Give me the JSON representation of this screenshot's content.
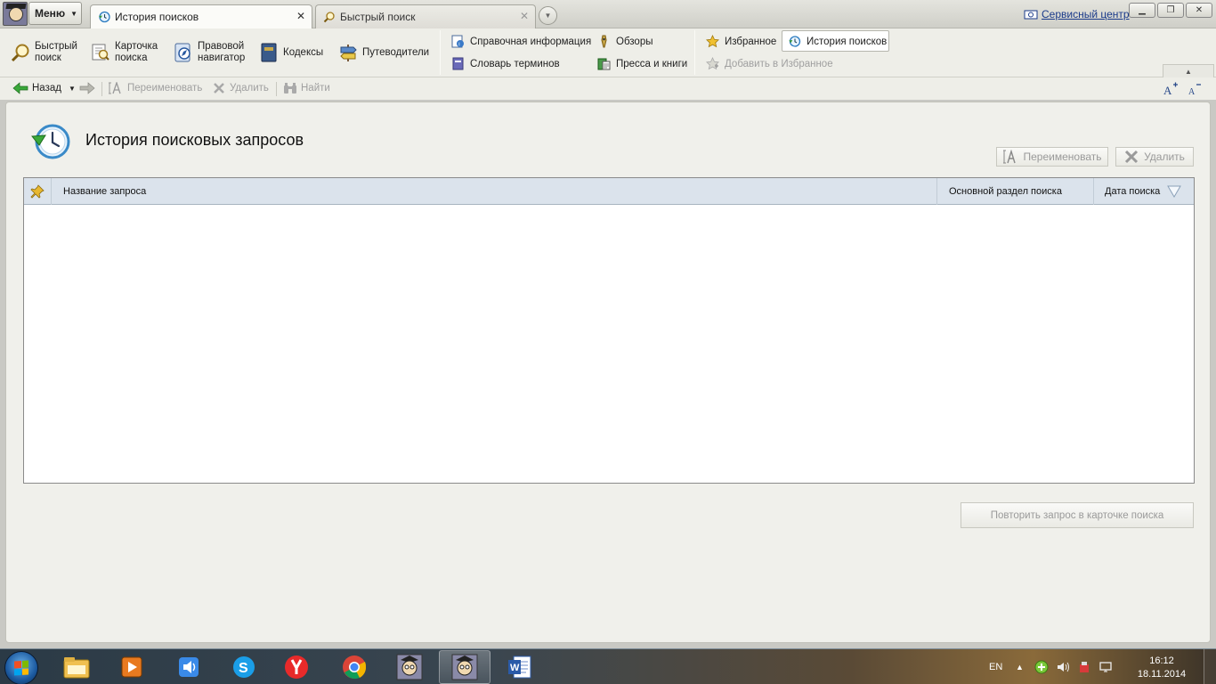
{
  "window": {
    "menu_label": "Меню",
    "tabs": [
      {
        "label": "История поисков",
        "active": true
      },
      {
        "label": "Быстрый поиск",
        "active": false
      }
    ],
    "service_center": "Сервисный центр"
  },
  "ribbon": {
    "main_buttons": [
      {
        "line1": "Быстрый",
        "line2": "поиск",
        "icon": "magnifier-icon"
      },
      {
        "line1": "Карточка",
        "line2": "поиска",
        "icon": "search-card-icon"
      },
      {
        "line1": "Правовой",
        "line2": "навигатор",
        "icon": "compass-icon"
      },
      {
        "line1": "Кодексы",
        "line2": "",
        "icon": "book-icon"
      },
      {
        "line1": "Путеводители",
        "line2": "",
        "icon": "signpost-icon"
      }
    ],
    "info_group": [
      {
        "label": "Справочная информация",
        "icon": "reference-icon"
      },
      {
        "label": "Словарь терминов",
        "icon": "dictionary-icon"
      },
      {
        "label": "Обзоры",
        "icon": "reviews-icon"
      },
      {
        "label": "Пресса и книги",
        "icon": "press-icon"
      }
    ],
    "favorites_group": {
      "favorites": "Избранное",
      "history": "История поисков",
      "add_favorite": "Добавить в Избранное"
    }
  },
  "navbar": {
    "back": "Назад",
    "rename": "Переименовать",
    "delete": "Удалить",
    "find": "Найти"
  },
  "page": {
    "title": "История поисковых запросов",
    "rename_button": "Переименовать",
    "delete_button": "Удалить",
    "table": {
      "columns": [
        "Название запроса",
        "Основной раздел поиска",
        "Дата поиска"
      ],
      "rows": []
    },
    "repeat_button": "Повторить запрос в карточке поиска"
  },
  "taskbar": {
    "apps": [
      "explorer-icon",
      "media-player-icon",
      "audio-icon",
      "skype-icon",
      "yandex-browser-icon",
      "chrome-icon",
      "consultant-icon",
      "consultant-icon-active",
      "word-icon"
    ],
    "language": "EN",
    "time": "16:12",
    "date": "18.11.2014"
  }
}
